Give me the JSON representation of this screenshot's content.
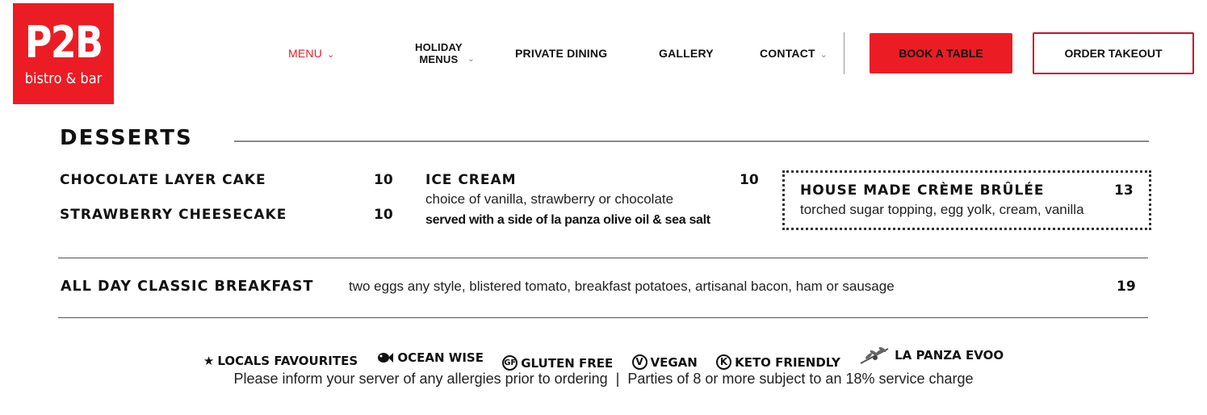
{
  "logo": {
    "line1": "P2B",
    "line2": "bistro & bar"
  },
  "nav": {
    "menu": "MENU",
    "holiday_line1": "HOLIDAY",
    "holiday_line2": "MENUS",
    "private_dining": "PRIVATE DINING",
    "gallery": "GALLERY",
    "contact": "CONTACT",
    "book": "BOOK A TABLE",
    "order": "ORDER TAKEOUT"
  },
  "colors": {
    "brand_red": "#ec1c24"
  },
  "desserts": {
    "title": "DESSERTS",
    "items": [
      {
        "name": "CHOCOLATE LAYER CAKE",
        "price": "10"
      },
      {
        "name": "STRAWBERRY CHEESECAKE",
        "price": "10"
      }
    ],
    "ice_cream": {
      "name": "ICE CREAM",
      "price": "10",
      "desc": "choice of vanilla, strawberry or chocolate",
      "desc2": "served with a side of la panza olive oil & sea salt"
    },
    "feature": {
      "name": "HOUSE MADE CRÈME BRÛLÉE",
      "price": "13",
      "desc": "torched sugar topping, egg yolk, cream, vanilla"
    }
  },
  "breakfast": {
    "name": "ALL DAY CLASSIC BREAKFAST",
    "desc": "two eggs any style, blistered tomato, breakfast potatoes, artisanal bacon, ham or sausage",
    "price": "19"
  },
  "legend": {
    "items": [
      {
        "icon": "star-icon",
        "label": "LOCALS FAVOURITES"
      },
      {
        "icon": "fish-icon",
        "label": "OCEAN WISE"
      },
      {
        "icon": "gf-icon",
        "glyph": "GF",
        "label": "GLUTEN FREE"
      },
      {
        "icon": "vegan-icon",
        "glyph": "V",
        "label": "VEGAN"
      },
      {
        "icon": "keto-icon",
        "glyph": "K",
        "label": "KETO FRIENDLY"
      },
      {
        "icon": "olive-branch-icon",
        "label": "LA PANZA EVOO"
      }
    ],
    "note": "Please inform your server of any allergies prior to ordering  |  Parties of 8 or more subject to an 18% service charge"
  }
}
